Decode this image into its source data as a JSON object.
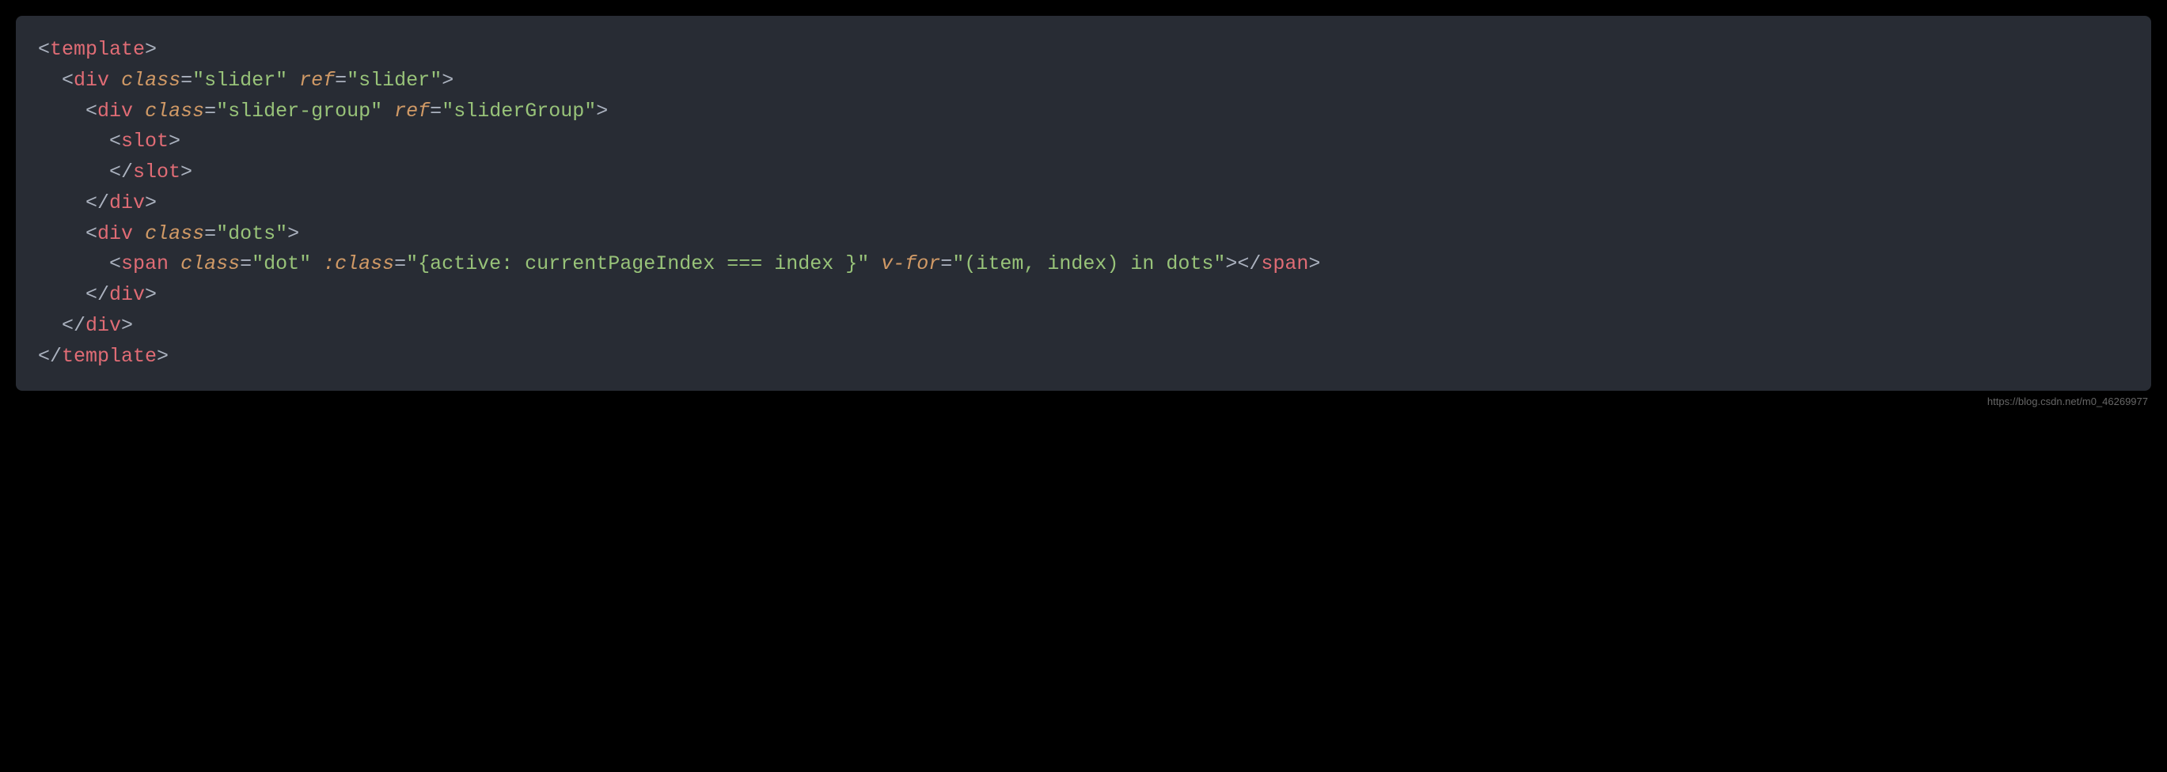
{
  "code": {
    "p_open": "<",
    "p_close": ">",
    "p_end_open": "</",
    "p_eq": "=",
    "tag_template": "template",
    "tag_div": "div",
    "tag_slot": "slot",
    "tag_span": "span",
    "attr_class": "class",
    "attr_bclass": ":class",
    "attr_ref": "ref",
    "attr_vfor": "v-for",
    "str_slider": "\"slider\"",
    "str_slider_ref": "\"slider\"",
    "str_slider_group": "\"slider-group\"",
    "str_sliderGroup": "\"sliderGroup\"",
    "str_dots": "\"dots\"",
    "str_dot": "\"dot\"",
    "str_bclass_val": "\"{active: currentPageIndex === index }\"",
    "str_vfor_val": "\"(item, index) in dots\"",
    "indent1": "  ",
    "indent2": "    ",
    "indent3": "      ",
    "space": " "
  },
  "footer": {
    "url": "https://blog.csdn.net/m0_46269977"
  }
}
